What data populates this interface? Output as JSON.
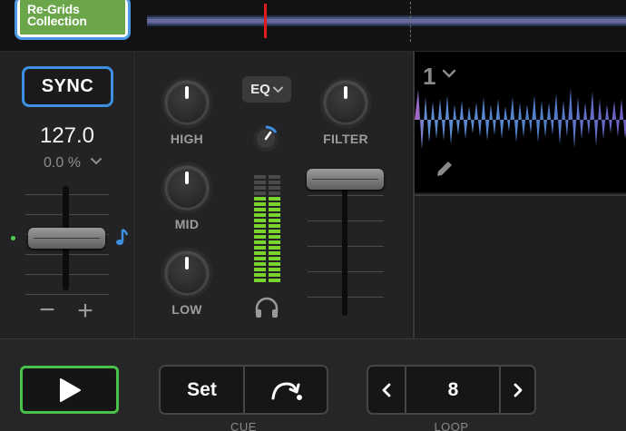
{
  "top": {
    "album_art_lines": [
      "Re-Grids",
      "Collection"
    ]
  },
  "left_panel": {
    "sync_label": "SYNC",
    "bpm": "127.0",
    "pitch": "0.0 %"
  },
  "mixer": {
    "eq_button_label": "EQ",
    "knobs": {
      "high": "HIGH",
      "mid": "MID",
      "low": "LOW",
      "filter": "FILTER"
    }
  },
  "right_panel": {
    "deck_number": "1"
  },
  "bottom": {
    "cue_set_label": "Set",
    "cue_section_label": "CUE",
    "loop_value": "8",
    "loop_section_label": "LOOP"
  },
  "colors": {
    "sync_accent": "#3d8fe0",
    "play_accent": "#4ac14a",
    "playhead": "#e01c1c",
    "vu_green": "#7bd42c"
  },
  "icons": {
    "play": "play-icon",
    "jump": "curved-arrow-icon",
    "prev": "chevron-left-icon",
    "next": "chevron-right-icon",
    "headphones": "headphones-icon",
    "pencil": "pencil-icon",
    "note": "music-note-icon"
  }
}
